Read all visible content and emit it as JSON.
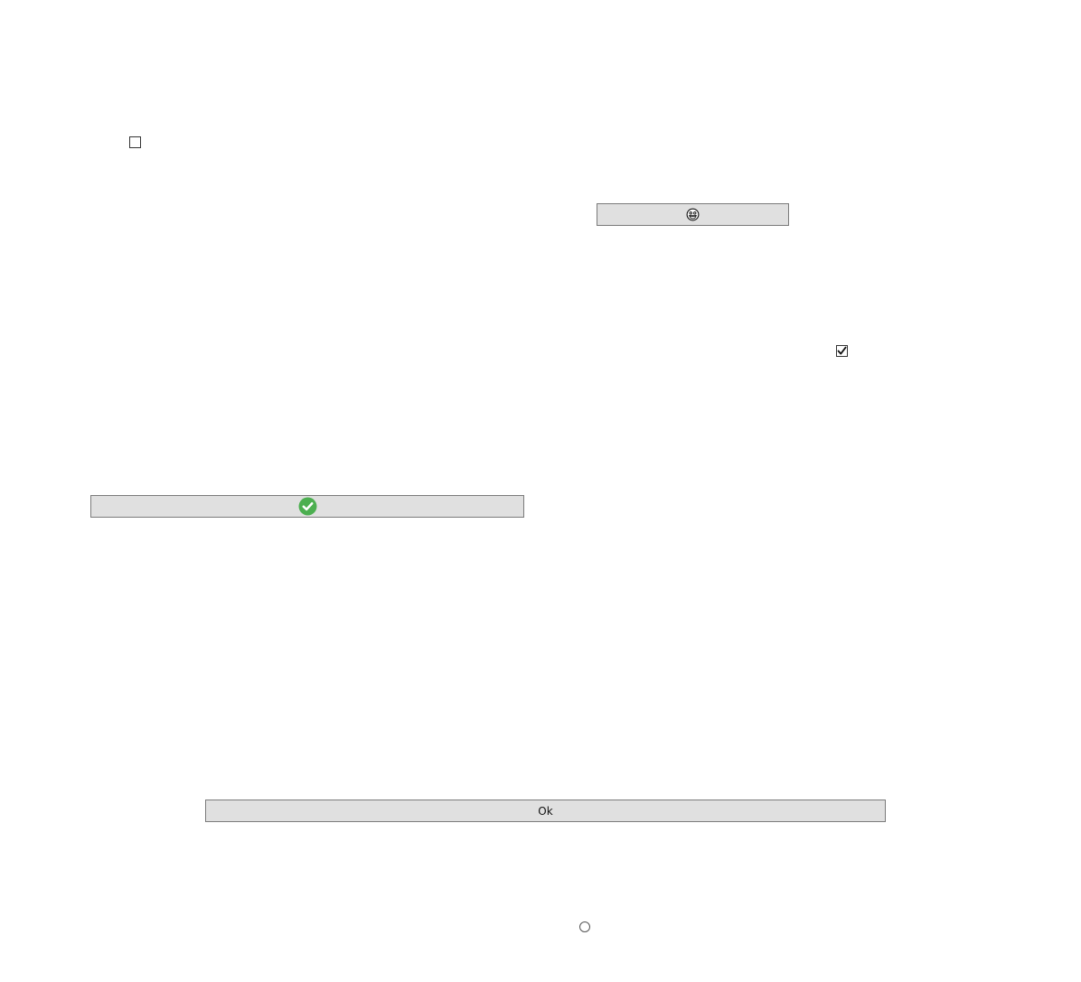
{
  "checkbox_unchecked": {
    "checked": false
  },
  "emoji_button": {
    "icon": "grinning-face-icon"
  },
  "checkbox_checked": {
    "checked": true,
    "icon": "checkmark-icon"
  },
  "check_button": {
    "icon": "green-check-circle-icon",
    "icon_color": "#4caf50"
  },
  "ok_button": {
    "label": "Ok"
  },
  "radio_button": {
    "selected": false
  }
}
